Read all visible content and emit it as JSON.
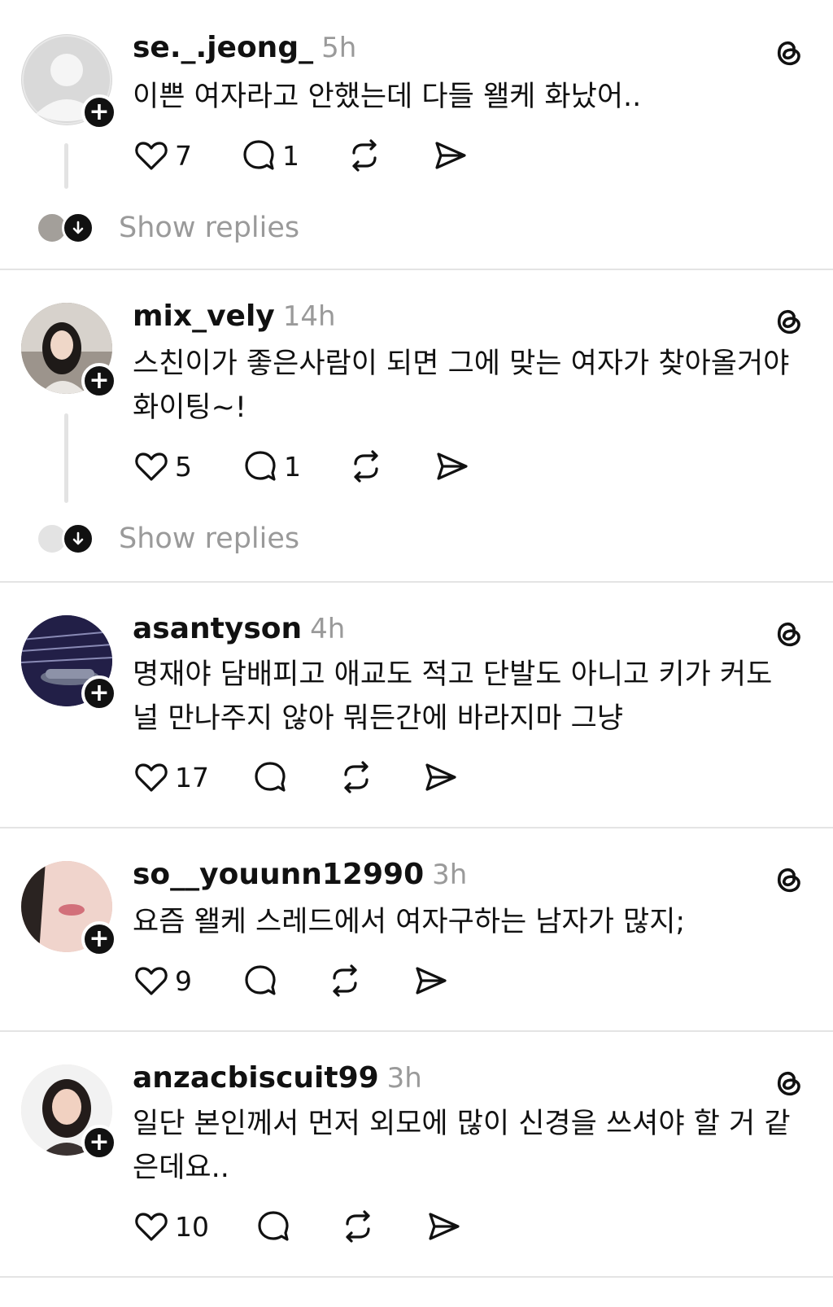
{
  "posts": [
    {
      "username": "se._.jeong_",
      "time": "5h",
      "text": "이쁜 여자라고 안했는데 다들 왤케 화났어..",
      "likes": "7",
      "replies": "1",
      "show_replies": "Show replies",
      "avatar_color": "#d6d6d6"
    },
    {
      "username": "mix_vely",
      "time": "14h",
      "text": "스친이가 좋은사람이 되면 그에 맞는 여자가 찾아올거야\n화이팅~!",
      "likes": "5",
      "replies": "1",
      "show_replies": "Show replies",
      "avatar_color": "#b9b2ab"
    },
    {
      "username": "asantyson",
      "time": "4h",
      "text": "명재야 담배피고 애교도 적고 단발도 아니고 키가 커도\n널 만나주지 않아 뭐든간에 바라지마 그냥",
      "likes": "17",
      "replies": "",
      "avatar_color": "#2c2a55"
    },
    {
      "username": "so__youunn12990",
      "time": "3h",
      "text": "요즘 왤케 스레드에서 여자구하는 남자가 많지;",
      "likes": "9",
      "replies": "",
      "avatar_color": "#e2b7ad"
    },
    {
      "username": "anzacbiscuit99",
      "time": "3h",
      "text": "일단 본인께서 먼저 외모에 많이 신경을 쓰셔야 할 거 같\n은데요..",
      "likes": "10",
      "replies": "",
      "avatar_color": "#e6ddd6"
    }
  ],
  "icons": {
    "threads": "threads-logo-icon",
    "like": "heart-icon",
    "reply": "speech-bubble-icon",
    "repost": "repost-icon",
    "share": "send-icon",
    "follow": "plus-icon",
    "expand": "arrow-down-icon"
  },
  "colors": {
    "text": "#111111",
    "muted": "#9a9a9a",
    "divider": "#e4e4e4"
  }
}
